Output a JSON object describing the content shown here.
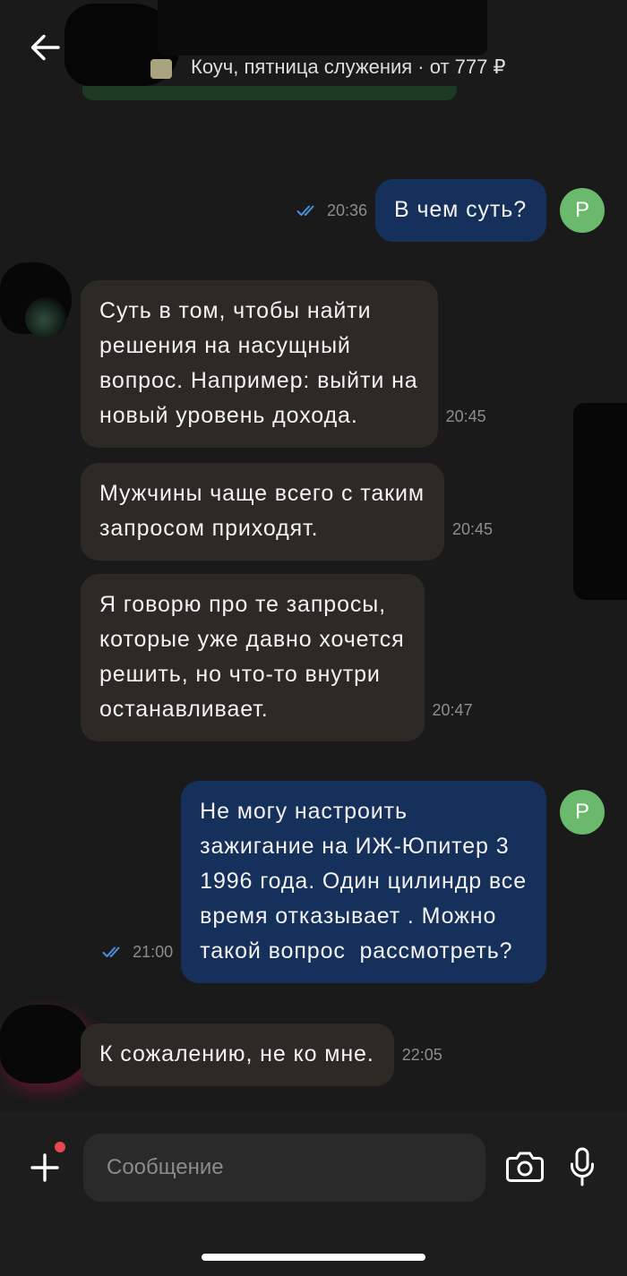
{
  "header": {
    "back_icon": "arrow-left-icon",
    "subtitle": "Коуч, пятница служения · от 777 ₽"
  },
  "messages": [
    {
      "outgoing": true,
      "text": "В чем суть?",
      "time": "20:36",
      "status_icon": "double-check-icon",
      "avatar_letter": "Р"
    },
    {
      "outgoing": false,
      "text": "Суть в том, чтобы найти\nрешения на насущный\nвопрос. Например: выйти на\nновый уровень дохода.",
      "time": "20:45"
    },
    {
      "outgoing": false,
      "text": "Мужчины чаще всего с таким\nзапросом приходят.",
      "time": "20:45"
    },
    {
      "outgoing": false,
      "text": "Я говорю про те запросы,\nкоторые уже давно хочется\nрешить, но что-то внутри\nостанавливает.",
      "time": "20:47"
    },
    {
      "outgoing": true,
      "text": "Не могу настроить\nзажигание на ИЖ-Юпитер 3\n1996 года. Один цилиндр все\nвремя отказывает . Можно\nтакой вопрос  рассмотреть?",
      "time": "21:00",
      "status_icon": "double-check-icon",
      "avatar_letter": "Р"
    },
    {
      "outgoing": false,
      "text": "К сожалению, не ко мне.",
      "time": "22:05"
    }
  ],
  "composer": {
    "attach_icon": "plus-icon",
    "notification_dot": true,
    "placeholder": "Сообщение",
    "camera_icon": "camera-icon",
    "mic_icon": "microphone-icon"
  },
  "colors": {
    "background": "#1a1a1a",
    "composer_background": "#1d1d1d",
    "incoming_bubble": "#2d2a25",
    "outgoing_bubble": "#15305a",
    "text": "#f2f2f2",
    "time": "#8d8d8d",
    "read_ticks": "#4d8fdf",
    "avatar": "#6ab96c",
    "input_background": "#2a2a2a",
    "notification_dot": "#e5484d"
  }
}
